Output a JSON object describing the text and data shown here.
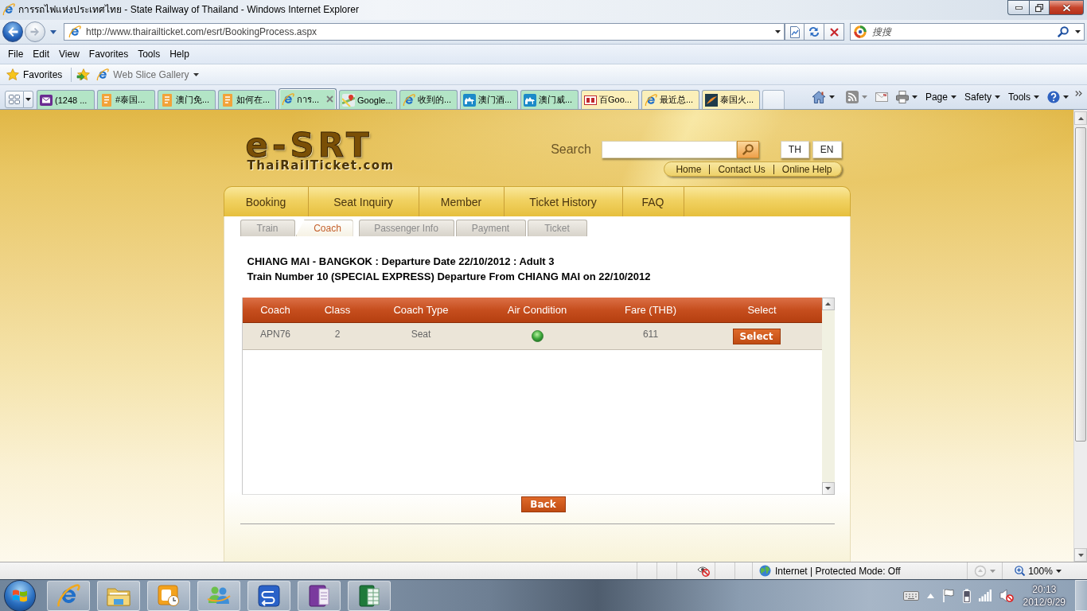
{
  "window": {
    "title": "การรถไฟแห่งประเทศไทย - State Railway of Thailand - Windows Internet Explorer"
  },
  "address_bar": {
    "url": "http://www.thairailticket.com/esrt/BookingProcess.aspx",
    "search_placeholder": "搜搜"
  },
  "menu_bar": [
    "File",
    "Edit",
    "View",
    "Favorites",
    "Tools",
    "Help"
  ],
  "favorites_bar": {
    "label": "Favorites",
    "items": [
      "Web Slice Gallery"
    ]
  },
  "tabs": [
    {
      "label": "(1248 ...",
      "kind": "mail",
      "color": "#b3e5c6",
      "selected": false
    },
    {
      "label": "#泰国...",
      "kind": "note",
      "color": "#b3e5c6",
      "selected": false
    },
    {
      "label": "澳门免...",
      "kind": "note",
      "color": "#b3e5c6",
      "selected": false
    },
    {
      "label": "如何在...",
      "kind": "note",
      "color": "#b3e5c6",
      "selected": false
    },
    {
      "label": "การ...",
      "kind": "ie",
      "color": "#b3e5c6",
      "selected": true
    },
    {
      "label": "Google...",
      "kind": "map",
      "color": "#b3e5c6",
      "selected": false
    },
    {
      "label": "收到的...",
      "kind": "ie",
      "color": "#b3e5c6",
      "selected": false
    },
    {
      "label": "澳门酒...",
      "kind": "camel",
      "color": "#b3e5c6",
      "selected": false
    },
    {
      "label": "澳门威...",
      "kind": "camel",
      "color": "#b3e5c6",
      "selected": false
    },
    {
      "label": "百Goo...",
      "kind": "tile",
      "color": "#fbefb9",
      "selected": false
    },
    {
      "label": "最近总...",
      "kind": "ie",
      "color": "#fbefb9",
      "selected": false
    },
    {
      "label": "泰国火...",
      "kind": "swoosh",
      "color": "#fbefb9",
      "selected": false
    }
  ],
  "command_bar": [
    "Page",
    "Safety",
    "Tools"
  ],
  "page": {
    "logo": {
      "title": "e-SRT",
      "subtitle": "ThaiRailTicket.com"
    },
    "search_label": "Search",
    "languages": [
      "TH",
      "EN"
    ],
    "links": [
      "Home",
      "Contact Us",
      "Online Help"
    ],
    "nav": [
      "Booking",
      "Seat Inquiry",
      "Member",
      "Ticket History",
      "FAQ"
    ],
    "steps": [
      {
        "label": "Train",
        "selected": false
      },
      {
        "label": "Coach",
        "selected": true
      },
      {
        "label": "Passenger Info",
        "selected": false
      },
      {
        "label": "Payment",
        "selected": false
      },
      {
        "label": "Ticket",
        "selected": false
      }
    ],
    "summary": [
      "CHIANG MAI - BANGKOK : Departure Date 22/10/2012 : Adult 3",
      "Train Number 10 (SPECIAL EXPRESS) Departure From CHIANG MAI on 22/10/2012"
    ],
    "table": {
      "columns": [
        "Coach",
        "Class",
        "Coach Type",
        "Air Condition",
        "Fare (THB)",
        "Select"
      ],
      "rows": [
        {
          "coach": "APN76",
          "class": "2",
          "coach_type": "Seat",
          "air_condition": true,
          "fare": "611",
          "action": "Select"
        }
      ]
    },
    "back_button": "Back"
  },
  "status_bar": {
    "zone": "Internet | Protected Mode: Off",
    "zoom": "100%"
  },
  "taskbar": {
    "time": "20:13",
    "date": "2012/9/29"
  }
}
